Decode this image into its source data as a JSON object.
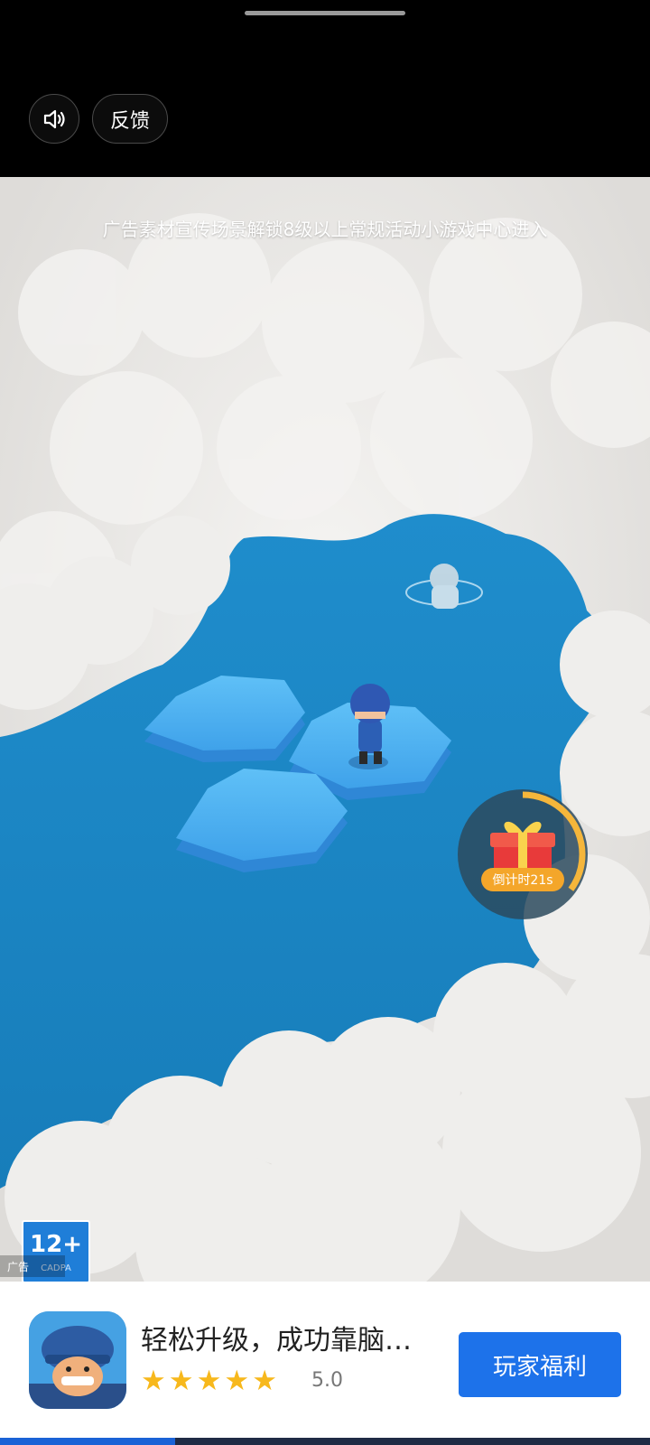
{
  "top_bar": {
    "feedback_label": "反馈"
  },
  "game": {
    "banner": "广告素材宣传场景解锁8级以上常规活动小游戏中心进入",
    "gift": {
      "label": "倒计时21s",
      "countdown_fraction": 0.35
    },
    "age_rating": {
      "value": "12+",
      "subtext": "CADPA"
    },
    "ad_label": "广告"
  },
  "app": {
    "icon": "soldier-avatar-icon",
    "title": "轻松升级，成功靠脑…",
    "rating_value": "5.0",
    "stars": 5,
    "cta_label": "玩家福利"
  },
  "progress": {
    "fraction": 0.27
  },
  "colors": {
    "water": "#1c86c4",
    "hex_tile": "#4db0f1",
    "cta": "#1d72ea",
    "star": "#f7b81c",
    "gift_ring": "#f5b63b"
  }
}
